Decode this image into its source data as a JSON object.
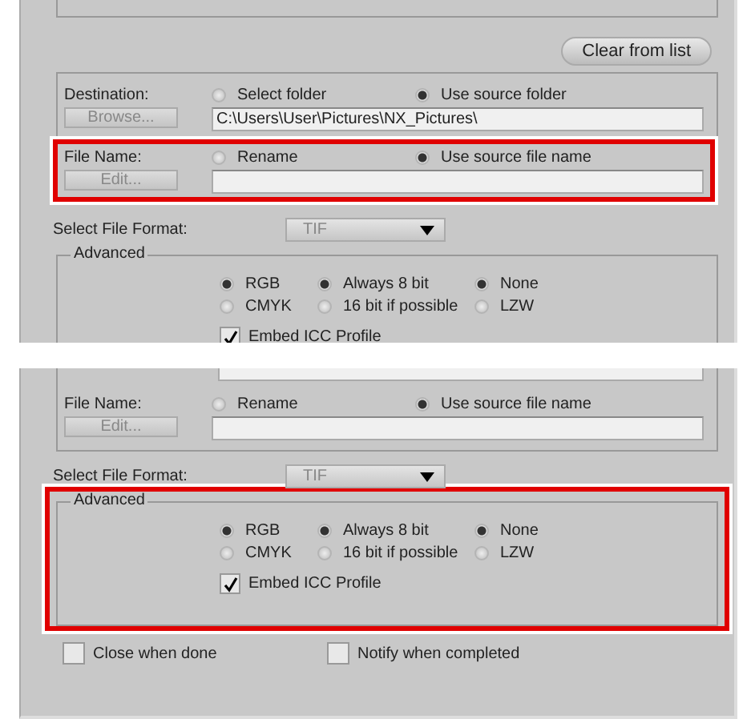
{
  "panels": [
    {
      "sections": [
        {
          "kind": "list-end"
        },
        {
          "kind": "clear",
          "label": "Clear from list"
        },
        {
          "kind": "output",
          "rows": [
            {
              "kind": "path",
              "label": "Destination:",
              "button": "Browse...",
              "options": [
                {
                  "label": "Select folder",
                  "selected": false
                },
                {
                  "label": "Use source folder",
                  "selected": true
                }
              ],
              "value": "C:\\Users\\User\\Pictures\\NX_Pictures\\",
              "highlighted": false
            },
            {
              "kind": "path",
              "label": "File Name:",
              "button": "Edit...",
              "options": [
                {
                  "label": "Rename",
                  "selected": false
                },
                {
                  "label": "Use source file name",
                  "selected": true
                }
              ],
              "highlighted": true
            }
          ]
        },
        {
          "kind": "format",
          "label": "Select File Format:",
          "value": "TIF"
        },
        {
          "kind": "advanced",
          "legend": "Advanced",
          "highlighted": false,
          "cut_bottom": true,
          "columns": [
            [
              {
                "label": "RGB",
                "selected": true
              },
              {
                "label": "CMYK",
                "selected": false
              }
            ],
            [
              {
                "label": "Always 8 bit",
                "selected": true
              },
              {
                "label": "16 bit if possible",
                "selected": false
              }
            ],
            [
              {
                "label": "None",
                "selected": true
              },
              {
                "label": "LZW",
                "selected": false
              }
            ]
          ],
          "checkbox": {
            "label": "Embed ICC Profile",
            "checked": true
          }
        }
      ]
    },
    {
      "sections": [
        {
          "kind": "output",
          "rows": [
            {
              "kind": "path-end"
            },
            {
              "kind": "path",
              "label": "File Name:",
              "button": "Edit...",
              "options": [
                {
                  "label": "Rename",
                  "selected": false
                },
                {
                  "label": "Use source file name",
                  "selected": true
                }
              ],
              "highlighted": false
            }
          ]
        },
        {
          "kind": "format",
          "label": "Select File Format:",
          "value": "TIF"
        },
        {
          "kind": "advanced",
          "legend": "Advanced",
          "highlighted": true,
          "cut_bottom": false,
          "columns": [
            [
              {
                "label": "RGB",
                "selected": true
              },
              {
                "label": "CMYK",
                "selected": false
              }
            ],
            [
              {
                "label": "Always 8 bit",
                "selected": true
              },
              {
                "label": "16 bit if possible",
                "selected": false
              }
            ],
            [
              {
                "label": "None",
                "selected": true
              },
              {
                "label": "LZW",
                "selected": false
              }
            ]
          ],
          "checkbox": {
            "label": "Embed ICC Profile",
            "checked": true
          }
        },
        {
          "kind": "checks",
          "items": [
            {
              "label": "Close when done",
              "checked": false
            },
            {
              "label": "Notify when completed",
              "checked": false
            }
          ]
        }
      ]
    }
  ]
}
